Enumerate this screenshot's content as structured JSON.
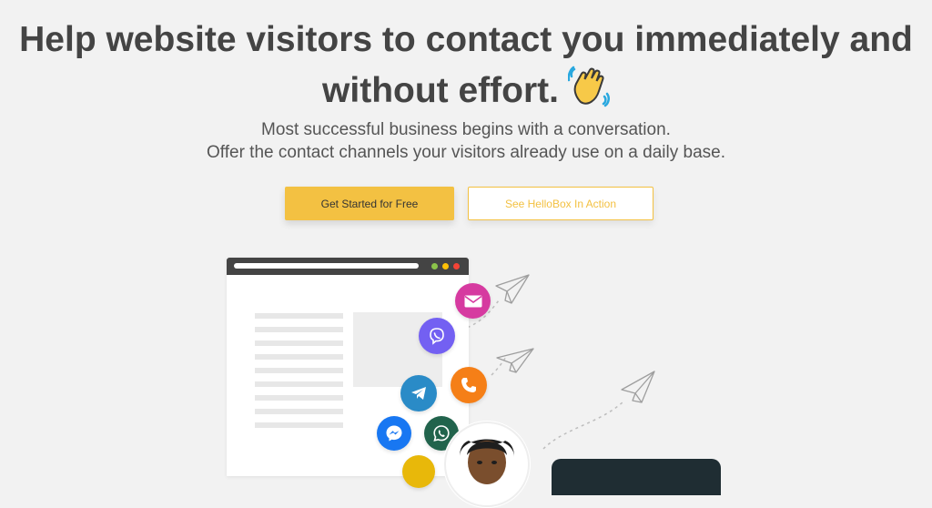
{
  "hero": {
    "headline_line1": "Help website visitors to contact you immediately and",
    "headline_line2": "without effort.",
    "headline_emoji": "waving-hand-icon",
    "subtext_line1": "Most successful business begins with a conversation.",
    "subtext_line2": "Offer the contact channels your visitors already use on a daily base."
  },
  "buttons": {
    "primary_label": "Get Started for Free",
    "secondary_label": "See HelloBox In Action"
  },
  "illustration": {
    "channels": [
      {
        "name": "email",
        "icon": "envelope-icon",
        "color": "#d63aa0"
      },
      {
        "name": "viber",
        "icon": "viber-icon",
        "color": "#7360f2"
      },
      {
        "name": "phone",
        "icon": "phone-icon",
        "color": "#f57f17"
      },
      {
        "name": "telegram",
        "icon": "telegram-icon",
        "color": "#2a8bc7"
      },
      {
        "name": "messenger",
        "icon": "messenger-icon",
        "color": "#1877f2"
      },
      {
        "name": "whatsapp",
        "icon": "whatsapp-icon",
        "color": "#21634c"
      },
      {
        "name": "other",
        "icon": "channel-icon",
        "color": "#e8b80a"
      }
    ]
  },
  "colors": {
    "accent": "#f3c142",
    "background": "#f2f2f2",
    "text": "#444444"
  }
}
